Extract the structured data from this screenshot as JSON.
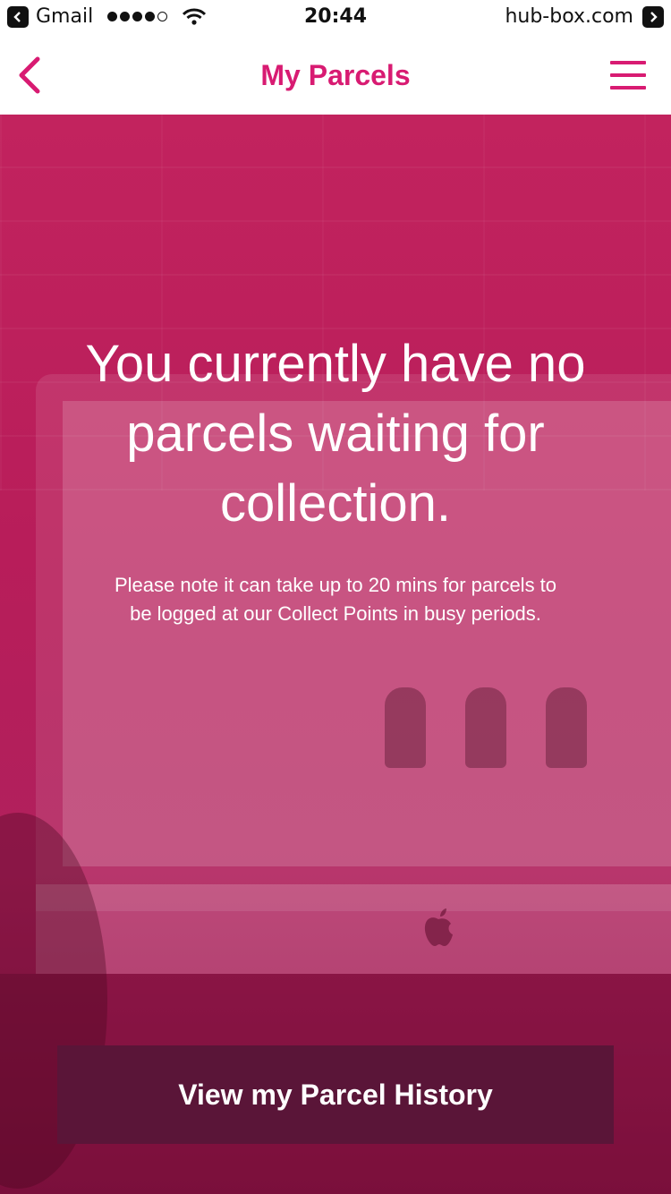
{
  "status_bar": {
    "back_app": "Gmail",
    "time": "20:44",
    "site": "hub-box.com",
    "signal_bars": 4,
    "signal_max": 5
  },
  "nav": {
    "title": "My Parcels",
    "back_icon": "chevron-left-icon",
    "menu_icon": "hamburger-menu-icon"
  },
  "main": {
    "headline": "You currently have no parcels waiting for collection.",
    "note": "Please note it can take up to 20 mins for parcels to be logged at our Collect Points in busy periods.",
    "history_button_label": "View my Parcel History"
  },
  "colors": {
    "brand_pink": "#d81b72",
    "overlay_pink": "#c2235e",
    "button_dark": "#5a1538"
  }
}
